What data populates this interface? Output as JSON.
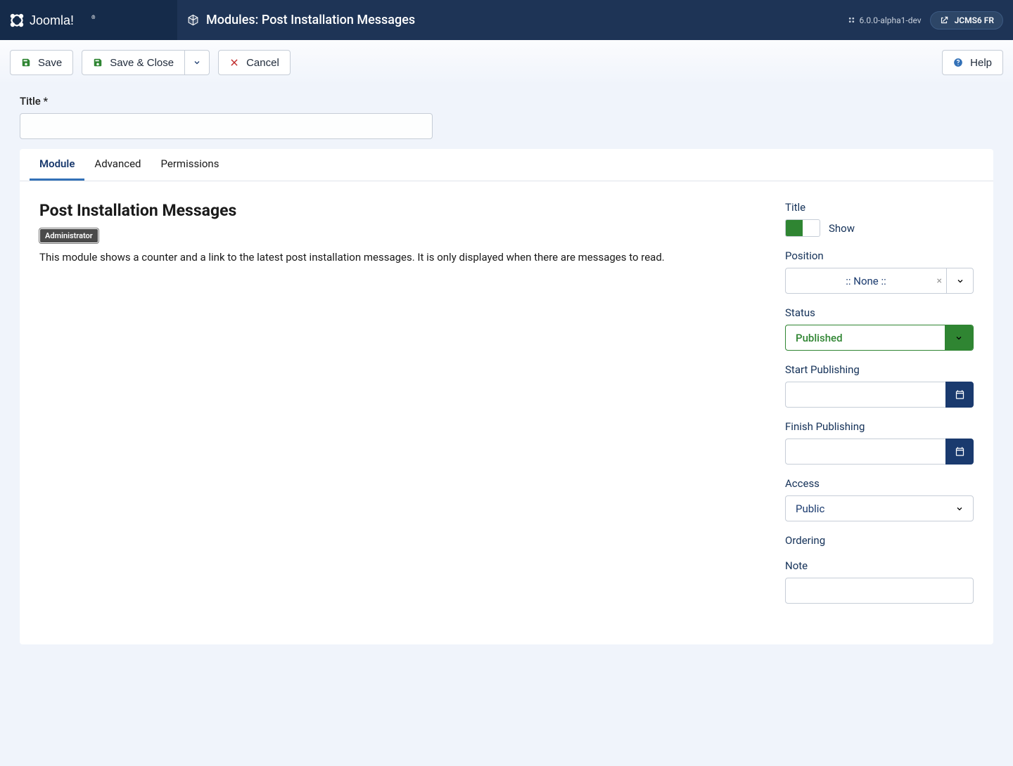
{
  "header": {
    "brand": "Joomla!",
    "page_title": "Modules: Post Installation Messages",
    "version": "6.0.0-alpha1-dev",
    "user": "JCMS6 FR"
  },
  "toolbar": {
    "save": "Save",
    "save_close": "Save & Close",
    "cancel": "Cancel",
    "help": "Help"
  },
  "form": {
    "title_label": "Title *",
    "title_value": ""
  },
  "tabs": {
    "module": "Module",
    "advanced": "Advanced",
    "permissions": "Permissions"
  },
  "module_info": {
    "heading": "Post Installation Messages",
    "badge": "Administrator",
    "description": "This module shows a counter and a link to the latest post installation messages. It is only displayed when there are messages to read."
  },
  "side": {
    "title_label": "Title",
    "title_toggle": "Show",
    "position_label": "Position",
    "position_value": ":: None ::",
    "status_label": "Status",
    "status_value": "Published",
    "start_label": "Start Publishing",
    "start_value": "",
    "finish_label": "Finish Publishing",
    "finish_value": "",
    "access_label": "Access",
    "access_value": "Public",
    "ordering_label": "Ordering",
    "note_label": "Note",
    "note_value": ""
  }
}
